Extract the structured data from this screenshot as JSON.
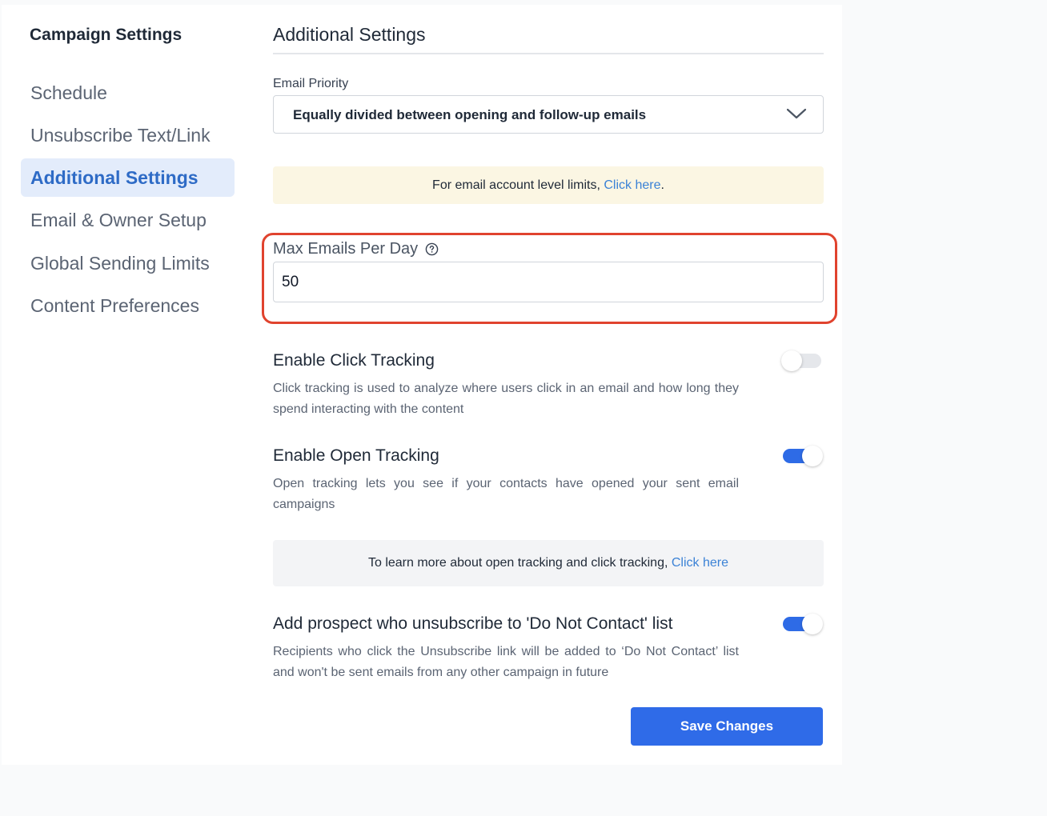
{
  "sidebar": {
    "title": "Campaign Settings",
    "items": [
      {
        "label": "Schedule"
      },
      {
        "label": "Unsubscribe Text/Link"
      },
      {
        "label": "Additional Settings",
        "active": true
      },
      {
        "label": "Email & Owner Setup"
      },
      {
        "label": "Global Sending Limits"
      },
      {
        "label": "Content Preferences"
      }
    ]
  },
  "main": {
    "title": "Additional Settings",
    "email_priority": {
      "label": "Email Priority",
      "selected": "Equally divided between opening and follow-up emails"
    },
    "account_limits_notice": {
      "text": "For email account level limits, ",
      "link": "Click here",
      "suffix": "."
    },
    "max_emails": {
      "label": "Max Emails Per Day",
      "value": "50"
    },
    "click_tracking": {
      "title": "Enable Click Tracking",
      "description": "Click tracking is used to analyze where users click in an email and how long they spend interacting with the content",
      "enabled": false
    },
    "open_tracking": {
      "title": "Enable Open Tracking",
      "description": "Open tracking lets you see if your contacts have opened your sent email campaigns",
      "enabled": true
    },
    "tracking_notice": {
      "text": "To learn more about open tracking and click tracking, ",
      "link": "Click here"
    },
    "do_not_contact": {
      "title": "Add prospect who unsubscribe to 'Do Not Contact' list",
      "description": "Recipients who click the Unsubscribe link will be added to ‘Do Not Contact’ list and won't be sent emails from any other campaign in future",
      "enabled": true
    },
    "save_label": "Save Changes"
  },
  "colors": {
    "accent": "#2f6be8",
    "active_nav_bg": "#e3ecfb",
    "active_nav_text": "#2e6bc6",
    "notice_yellow": "#fbf6e3",
    "highlight_ring": "#e0432e",
    "link": "#3b82d6"
  },
  "icons": {
    "dropdown": "chevron-down-icon",
    "help": "help-circle-icon"
  }
}
